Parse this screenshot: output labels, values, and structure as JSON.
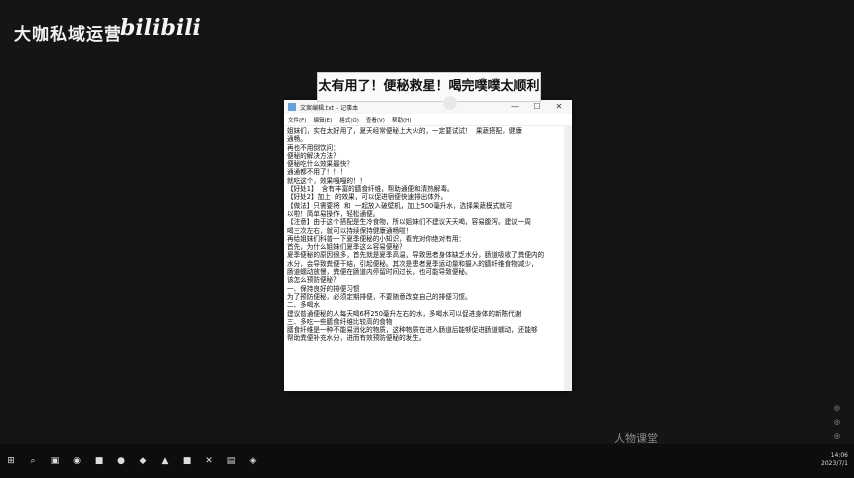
{
  "overlay": {
    "channel_name": "大咖私域运营",
    "platform_logo": "bilibili",
    "banner_text": "太有用了！便秘救星！喝完噗噗太顺利",
    "bottom_watermark": "人物课堂"
  },
  "notepad": {
    "title": "文案编辑.txt - 记事本",
    "menus": [
      "文件(F)",
      "编辑(E)",
      "格式(O)",
      "查看(V)",
      "帮助(H)"
    ],
    "lines": [
      "姐妹们，实在太好用了，夏天经常便秘上大火的，一定要试试！  果蔬搭配，健康",
      "通畅。",
      "再也不用倒饮问：",
      "便秘的解决方法？",
      "便秘吃什么效果最快？",
      "通通都不用了！！！",
      "就吃这个，效果嘎嘎的！！",
      "【好处1】  含有丰富的膳食纤维，帮助通便和清热解毒。",
      "【好处2】加上  的效果，可以促进宿便快速排出体外。",
      "【做法】只需要将  和  一起放入破壁机，加上500毫升水，选择果蔬模式就可",
      "以啦！简单易操作，轻松通便。",
      "【注意】由于这个搭配是生冷食物，所以姐妹们不建议天天喝，容易腹泻。建议一周",
      "喝三次左右，就可以持续保持健康通畅啦！",
      "",
      "再给姐妹们科普一下夏季便秘的小知识，看完对你绝对有用：",
      "首先，为什么姐妹们夏季这么容易便秘？",
      "夏季便秘的原因很多，首先就是夏季高温，导致思者身体缺乏水分，肠道吸收了粪便内的",
      "水分，会导致粪便干结，引起便秘。其次是患者夏季运动量和摄入的膳纤维食物减少，",
      "肠道蠕动放慢，粪便在肠道内停留时间过长，也可能导致便秘。",
      "",
      "该怎么预防便秘？",
      "一、保持良好的排便习惯",
      "为了预防便秘，必须定期排便，不要随意改变自己的排便习惯。",
      "二、多喝水",
      "建议普通便秘的人每天喝6杯250毫升左右的水，多喝水可以促进身体的新陈代谢",
      "三、多吃一些膳食纤维比较高的食物",
      "膳食纤维是一种不能易消化的物质，这种物质在进入肠道后能够促进肠道蠕动，还能够",
      "帮助粪便补充水分，进而有效预防便秘的发生。"
    ]
  },
  "taskbar": {
    "time": "14:06",
    "date": "2023/7/1"
  }
}
